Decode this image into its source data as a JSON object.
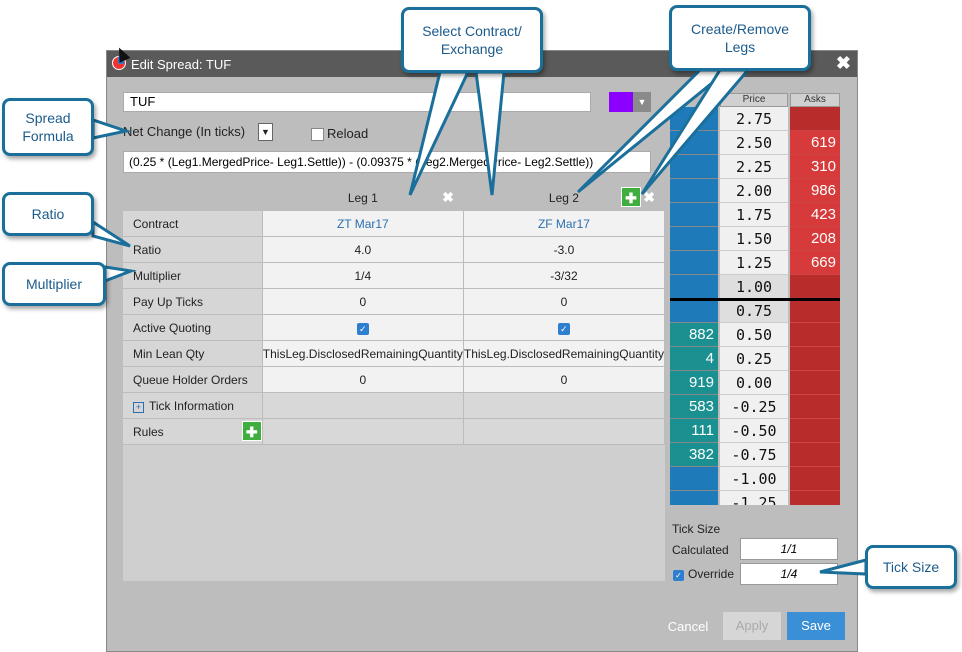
{
  "window": {
    "title": "Edit Spread: TUF",
    "close_glyph": "✖"
  },
  "spread": {
    "name": "TUF",
    "color": "#8b00ff",
    "formula_type": "Net Change (In ticks)",
    "reload_label": "Reload",
    "formula": "(0.25 * (Leg1.MergedPrice- Leg1.Settle)) - (0.09375 * (Leg2.MergedPrice- Leg2.Settle))"
  },
  "legs_table": {
    "columns": [
      "Leg 1",
      "Leg 2"
    ],
    "rows": [
      {
        "label": "Contract",
        "values": [
          "ZT Mar17",
          "ZF Mar17"
        ]
      },
      {
        "label": "Ratio",
        "values": [
          "4.0",
          "-3.0"
        ]
      },
      {
        "label": "Multiplier",
        "values": [
          "1/4",
          "-3/32"
        ]
      },
      {
        "label": "Pay Up Ticks",
        "values": [
          "0",
          "0"
        ]
      },
      {
        "label": "Active Quoting",
        "values": [
          "",
          ""
        ]
      },
      {
        "label": "Min Lean Qty",
        "values": [
          "ThisLeg.DisclosedRemainingQuantity",
          "ThisLeg.DisclosedRemainingQuantity"
        ]
      },
      {
        "label": "Queue Holder Orders",
        "values": [
          "0",
          "0"
        ]
      }
    ],
    "tick_info_label": "Tick Information",
    "rules_label": "Rules",
    "plus_glyph": "✚",
    "check_glyph": "✓",
    "expand_glyph": "+"
  },
  "ladder": {
    "headers": {
      "bid": "",
      "price": "Price",
      "ask": "Asks"
    },
    "rows": [
      {
        "bid": "",
        "price": "2.75",
        "ask": ""
      },
      {
        "bid": "",
        "price": "2.50",
        "ask": "619"
      },
      {
        "bid": "",
        "price": "2.25",
        "ask": "310"
      },
      {
        "bid": "",
        "price": "2.00",
        "ask": "986"
      },
      {
        "bid": "",
        "price": "1.75",
        "ask": "423"
      },
      {
        "bid": "",
        "price": "1.50",
        "ask": "208"
      },
      {
        "bid": "",
        "price": "1.25",
        "ask": "669"
      },
      {
        "bid": "",
        "price": "1.00",
        "ask": ""
      },
      {
        "bid": "",
        "price": "0.75",
        "ask": ""
      },
      {
        "bid": "882",
        "price": "0.50",
        "ask": ""
      },
      {
        "bid": "4",
        "price": "0.25",
        "ask": ""
      },
      {
        "bid": "919",
        "price": "0.00",
        "ask": ""
      },
      {
        "bid": "583",
        "price": "-0.25",
        "ask": ""
      },
      {
        "bid": "111",
        "price": "-0.50",
        "ask": ""
      },
      {
        "bid": "382",
        "price": "-0.75",
        "ask": ""
      },
      {
        "bid": "",
        "price": "-1.00",
        "ask": ""
      },
      {
        "bid": "",
        "price": "-1.25",
        "ask": ""
      }
    ]
  },
  "tick_size": {
    "label": "Tick Size",
    "calculated_label": "Calculated",
    "calculated_value": "1/1",
    "override_label": "Override",
    "override_value": "1/4"
  },
  "buttons": {
    "cancel": "Cancel",
    "apply": "Apply",
    "save": "Save"
  },
  "callouts": {
    "select_contract": "Select Contract/\nExchange",
    "create_remove": "Create/Remove\nLegs",
    "spread_formula": "Spread\nFormula",
    "ratio": "Ratio",
    "multiplier": "Multiplier",
    "tick_size": "Tick Size"
  },
  "colors": {
    "accent": "#3b8fd6",
    "callout_border": "#1b6f9b",
    "ask": "#b82c2c",
    "bid": "#1a9090",
    "add": "#3fae3f"
  }
}
